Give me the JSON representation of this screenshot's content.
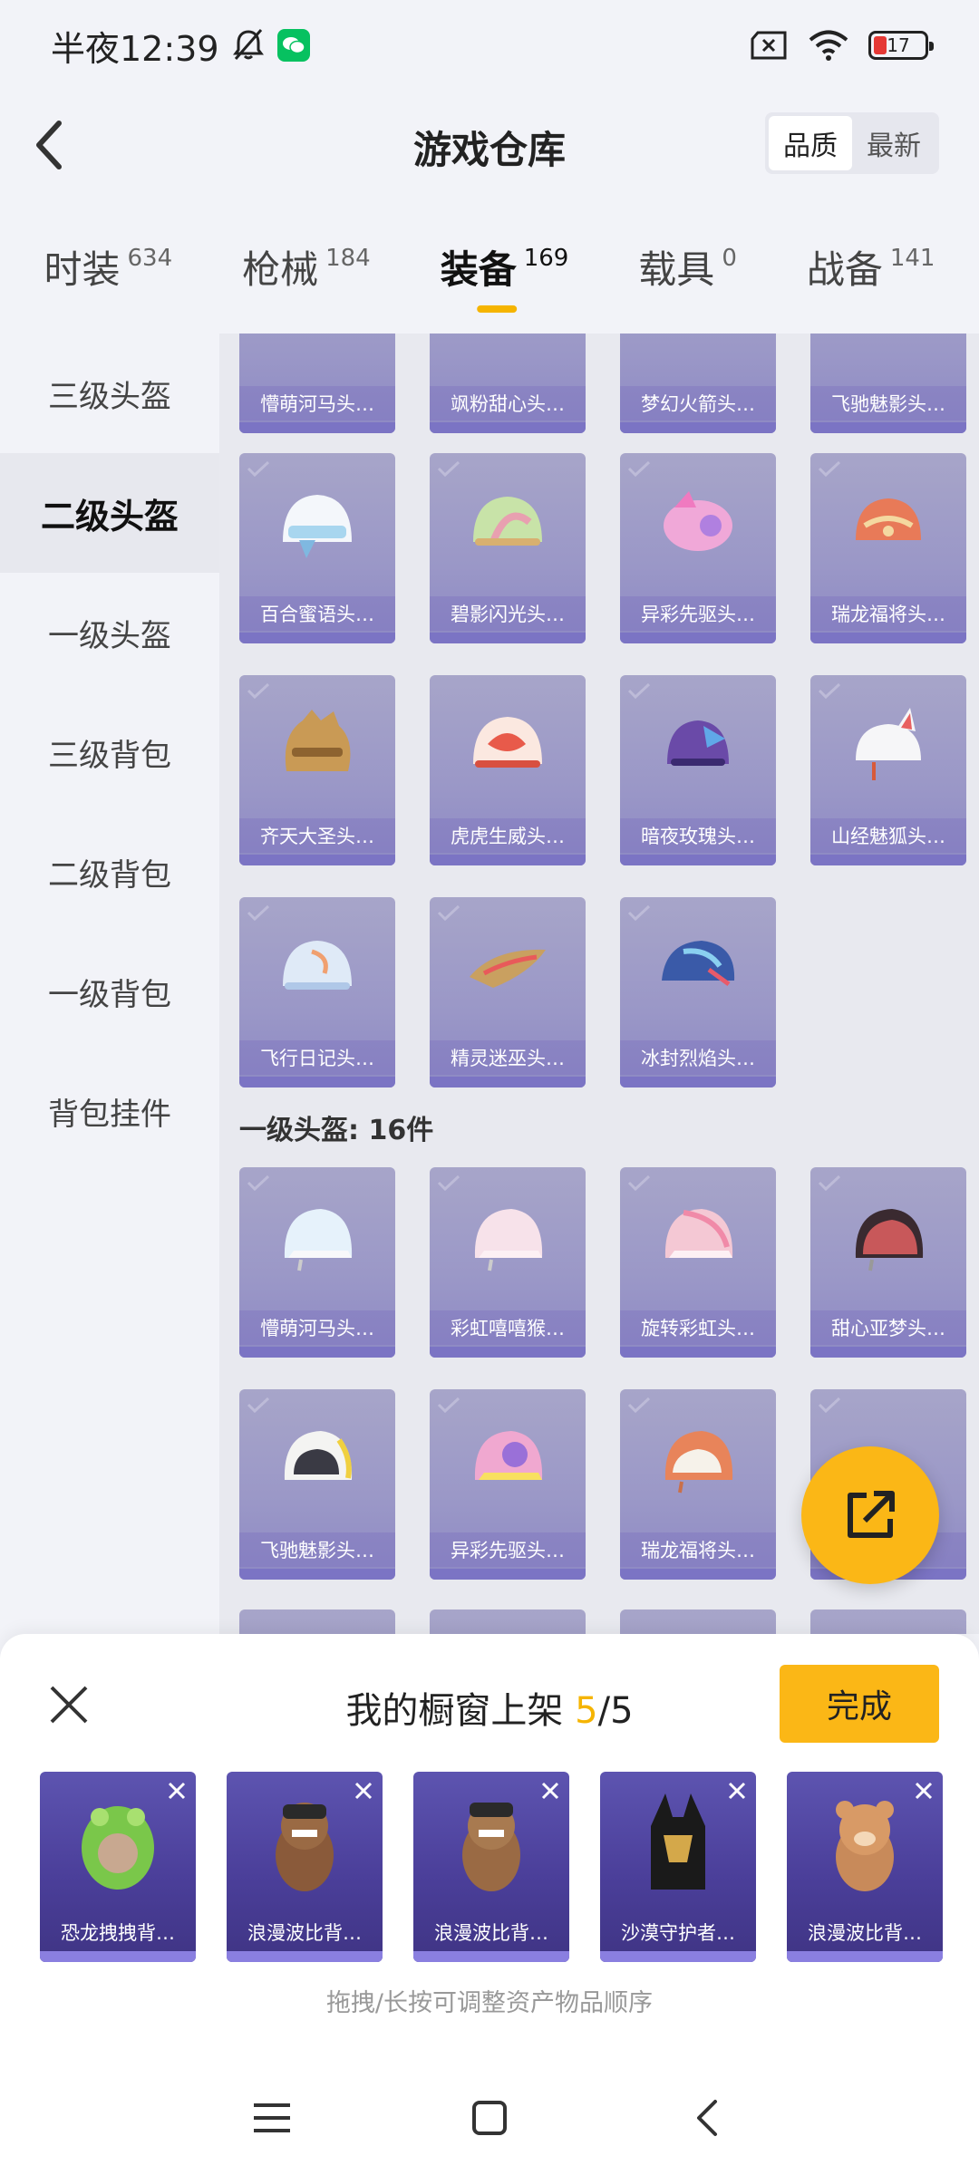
{
  "status": {
    "time": "半夜12:39",
    "battery_level": "17"
  },
  "header": {
    "title": "游戏仓库",
    "sort_options": [
      "品质",
      "最新"
    ],
    "sort_selected": "品质"
  },
  "tabs": [
    {
      "label": "时装",
      "count": "634"
    },
    {
      "label": "枪械",
      "count": "184"
    },
    {
      "label": "装备",
      "count": "169",
      "active": true
    },
    {
      "label": "载具",
      "count": "0"
    },
    {
      "label": "战备",
      "count": "141"
    }
  ],
  "sidebar": {
    "items": [
      "三级头盔",
      "二级头盔",
      "一级头盔",
      "三级背包",
      "二级背包",
      "一级背包",
      "背包挂件"
    ],
    "active_index": 1
  },
  "grid": {
    "row0": [
      "懵萌河马头…",
      "飒粉甜心头…",
      "梦幻火箭头…",
      "飞驰魅影头…"
    ],
    "row1": [
      "百合蜜语头…",
      "碧影闪光头…",
      "异彩先驱头…",
      "瑞龙福将头…"
    ],
    "row2": [
      "齐天大圣头…",
      "虎虎生威头…",
      "暗夜玫瑰头…",
      "山经魅狐头…"
    ],
    "row3": [
      "飞行日记头…",
      "精灵迷巫头…",
      "冰封烈焰头…"
    ],
    "section_title": "一级头盔: 16件",
    "row4": [
      "懵萌河马头…",
      "彩虹嘻嘻猴…",
      "旋转彩虹头…",
      "甜心亚梦头…"
    ],
    "row5": [
      "飞驰魅影头…",
      "异彩先驱头…",
      "瑞龙福将头…",
      "…"
    ]
  },
  "panel": {
    "title_prefix": "我的橱窗上架 ",
    "count": "5",
    "total": "/5",
    "done_label": "完成",
    "items": [
      "恐龙拽拽背…",
      "浪漫波比背…",
      "浪漫波比背…",
      "沙漠守护者…",
      "浪漫波比背…"
    ],
    "hint": "拖拽/长按可调整资产物品顺序"
  },
  "colors": {
    "accent": "#fbb716",
    "card_purple": "#9a97c7",
    "shelf_purple": "#4b3f9a"
  }
}
